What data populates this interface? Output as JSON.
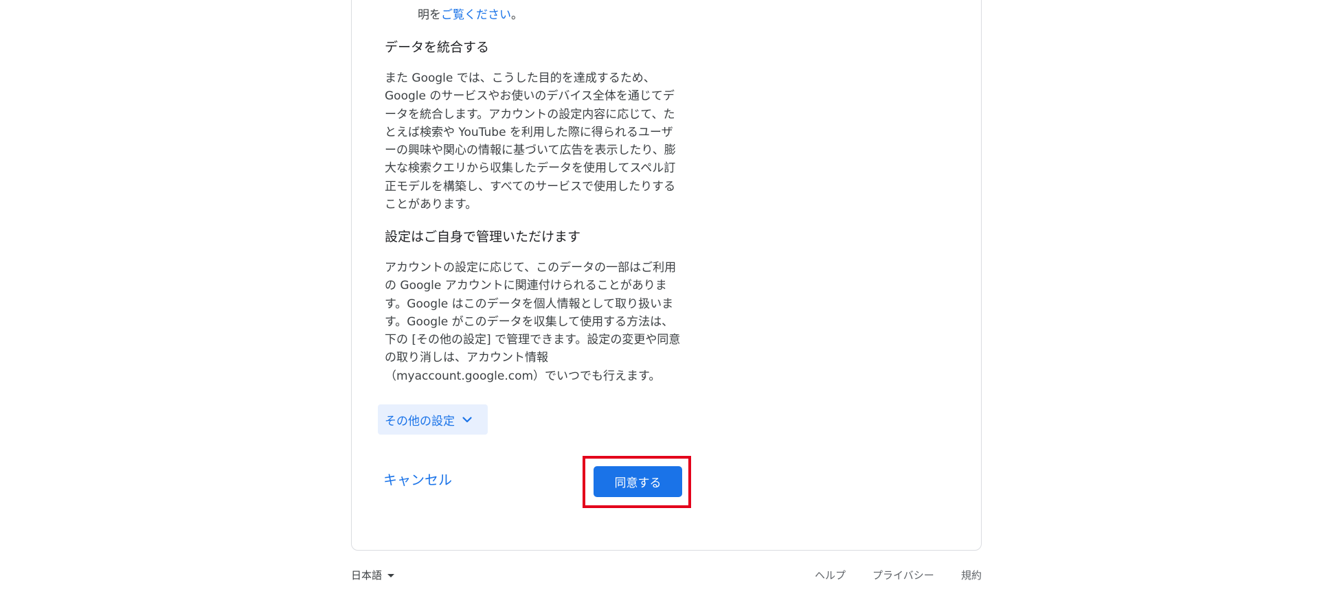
{
  "top_fragment": {
    "prefix": "明を",
    "link": "ご覧ください",
    "suffix": "。"
  },
  "sections": [
    {
      "heading": "データを統合する",
      "body": "また Google では、こうした目的を達成するため、Google のサービスやお使いのデバイス全体を通じてデータを統合します。アカウントの設定内容に応じて、たとえば検索や YouTube を利用した際に得られるユーザーの興味や関心の情報に基づいて広告を表示したり、膨大な検索クエリから収集したデータを使用してスペル訂正モデルを構築し、すべてのサービスで使用したりすることがあります。"
    },
    {
      "heading": "設定はご自身で管理いただけます",
      "body": "アカウントの設定に応じて、このデータの一部はご利用の Google アカウントに関連付けられることがあります。Google はこのデータを個人情報として取り扱います。Google がこのデータを収集して使用する方法は、下の [その他の設定] で管理できます。設定の変更や同意の取り消しは、アカウント情報（myaccount.google.com）でいつでも行えます。"
    }
  ],
  "buttons": {
    "more_settings": "その他の設定",
    "cancel": "キャンセル",
    "agree": "同意する"
  },
  "footer": {
    "language": "日本語",
    "help": "ヘルプ",
    "privacy": "プライバシー",
    "terms": "規約"
  },
  "colors": {
    "accent": "#1a73e8",
    "highlight": "#e3001b"
  }
}
